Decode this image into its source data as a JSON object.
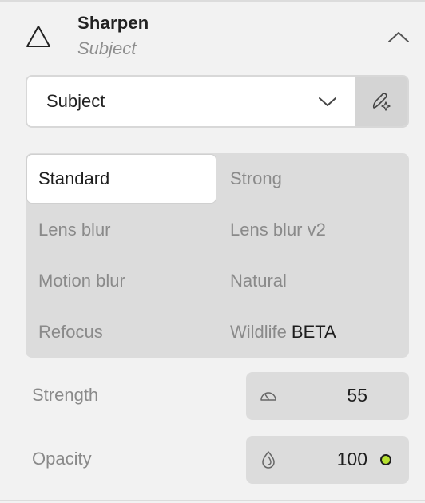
{
  "header": {
    "title": "Sharpen",
    "subtitle": "Subject",
    "icon": "triangle-icon",
    "collapse_icon": "chevron-up-icon"
  },
  "mask_dropdown": {
    "value": "Subject",
    "icon": "chevron-down-icon",
    "mask_button_icon": "pencil-sparkle-icon"
  },
  "models": [
    {
      "label": "Standard",
      "selected": true
    },
    {
      "label": "Strong",
      "selected": false
    },
    {
      "label": "Lens blur",
      "selected": false
    },
    {
      "label": "Lens blur v2",
      "selected": false
    },
    {
      "label": "Motion blur",
      "selected": false
    },
    {
      "label": "Natural",
      "selected": false
    },
    {
      "label": "Refocus",
      "selected": false
    },
    {
      "label": "Wildlife",
      "badge": "BETA",
      "selected": false
    }
  ],
  "params": {
    "strength": {
      "label": "Strength",
      "value": "55",
      "icon": "gauge-icon"
    },
    "opacity": {
      "label": "Opacity",
      "value": "100",
      "icon": "drop-icon",
      "indicator_color": "#b6e12f"
    }
  },
  "colors": {
    "background": "#f2f2f2",
    "selected_item": "#ffffff",
    "group_background": "#dcdcdc",
    "accent_dot": "#b6e12f"
  }
}
